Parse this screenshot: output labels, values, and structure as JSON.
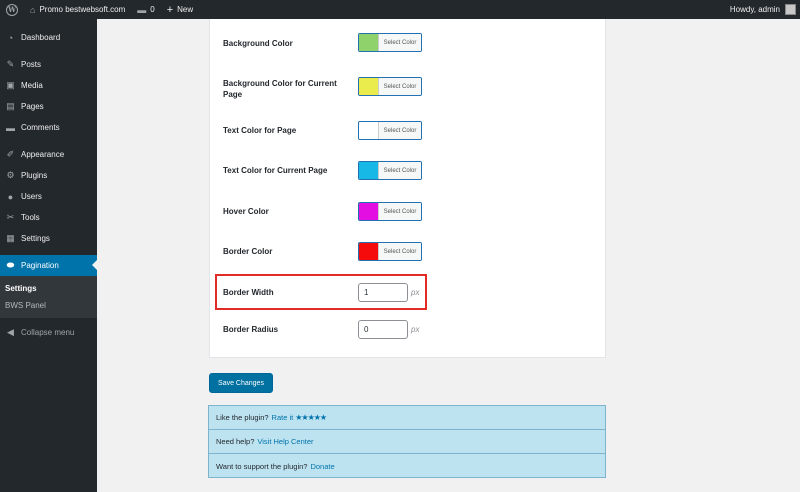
{
  "adminbar": {
    "site_name": "Promo bestwebsoft.com",
    "comments_count": "0",
    "new_label": "New",
    "greeting": "Howdy, admin"
  },
  "sidebar": {
    "items": [
      {
        "label": "Dashboard",
        "icon": "dashboard-icon"
      },
      {
        "label": "Posts",
        "icon": "pin-icon"
      },
      {
        "label": "Media",
        "icon": "media-icon"
      },
      {
        "label": "Pages",
        "icon": "pages-icon"
      },
      {
        "label": "Comments",
        "icon": "comment-icon"
      },
      {
        "label": "Appearance",
        "icon": "brush-icon"
      },
      {
        "label": "Plugins",
        "icon": "plugin-icon"
      },
      {
        "label": "Users",
        "icon": "user-icon"
      },
      {
        "label": "Tools",
        "icon": "wrench-icon"
      },
      {
        "label": "Settings",
        "icon": "settings-icon"
      },
      {
        "label": "Pagination",
        "icon": "toggle-icon"
      }
    ],
    "submenu": [
      {
        "label": "Settings"
      },
      {
        "label": "BWS Panel"
      }
    ],
    "collapse_label": "Collapse menu"
  },
  "settings": {
    "button_text": "Select Color",
    "rows": [
      {
        "label": "Background Color",
        "color": "#8fd16a"
      },
      {
        "label": "Background Color for Current Page",
        "color": "#e9ec4c"
      },
      {
        "label": "Text Color for Page",
        "color": "#ffffff"
      },
      {
        "label": "Text Color for Current Page",
        "color": "#17b8e6"
      },
      {
        "label": "Hover Color",
        "color": "#e30ee1"
      },
      {
        "label": "Border Color",
        "color": "#f50b0b"
      }
    ],
    "border_width": {
      "label": "Border Width",
      "value": "1",
      "unit": "px"
    },
    "border_radius": {
      "label": "Border Radius",
      "value": "0",
      "unit": "px"
    }
  },
  "save_label": "Save Changes",
  "info": {
    "rate_text": "Like the plugin?",
    "rate_link": "Rate it",
    "stars": "★★★★★",
    "help_text": "Need help?",
    "help_link": "Visit Help Center",
    "support_text": "Want to support the plugin?",
    "support_link": "Donate"
  },
  "colors": {
    "accent": "#0073aa",
    "highlight": "#e02b27"
  }
}
